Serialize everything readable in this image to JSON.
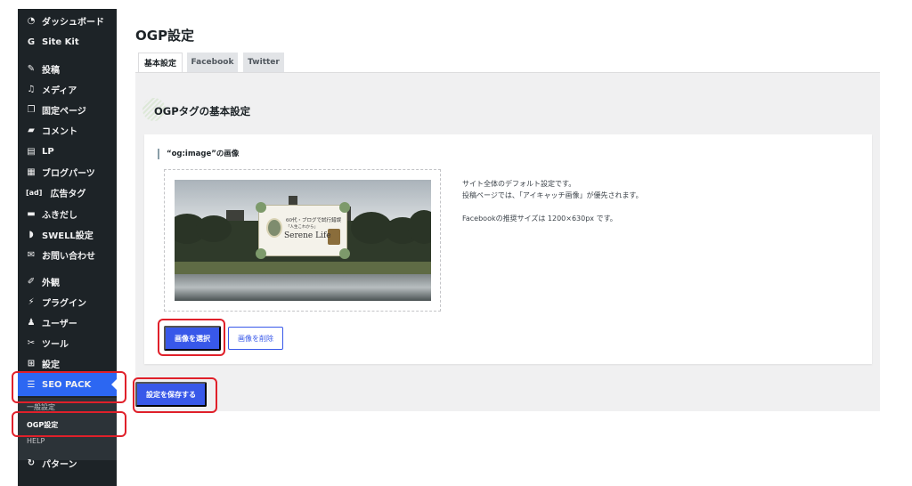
{
  "sidebar": {
    "items": [
      {
        "label": "ダッシュボード",
        "icon": "dashboard-icon"
      },
      {
        "label": "Site Kit",
        "icon": "google-g-icon"
      },
      {
        "label": "投稿",
        "icon": "pin-icon"
      },
      {
        "label": "メディア",
        "icon": "media-icon"
      },
      {
        "label": "固定ページ",
        "icon": "pages-icon"
      },
      {
        "label": "コメント",
        "icon": "comment-icon"
      },
      {
        "label": "LP",
        "icon": "document-icon"
      },
      {
        "label": "ブログパーツ",
        "icon": "layout-icon"
      },
      {
        "label": "広告タグ",
        "icon": "ad-icon",
        "icon_text": "[ad]"
      },
      {
        "label": "ふきだし",
        "icon": "speech-bubble-icon"
      },
      {
        "label": "SWELL設定",
        "icon": "swell-icon"
      },
      {
        "label": "お問い合わせ",
        "icon": "mail-icon"
      },
      {
        "label": "外観",
        "icon": "brush-icon"
      },
      {
        "label": "プラグイン",
        "icon": "plugin-icon"
      },
      {
        "label": "ユーザー",
        "icon": "user-icon"
      },
      {
        "label": "ツール",
        "icon": "wrench-icon"
      },
      {
        "label": "設定",
        "icon": "settings-icon"
      },
      {
        "label": "SEO PACK",
        "icon": "list-icon"
      }
    ],
    "submenu": [
      {
        "label": "一般設定"
      },
      {
        "label": "OGP設定"
      }
    ],
    "help_label": "HELP",
    "pattern_label": "パターン"
  },
  "page": {
    "title": "OGP設定",
    "tabs": [
      {
        "label": "基本設定"
      },
      {
        "label": "Facebook"
      },
      {
        "label": "Twitter"
      }
    ],
    "section_title": "OGPタグの基本設定",
    "field_label": "“og:image”の画像",
    "description": [
      "サイト全体のデフォルト設定です。",
      "投稿ページでは、「アイキャッチ画像」が優先されます。",
      "Facebookの推奨サイズは 1200×630px です。"
    ],
    "select_image_label": "画像を選択",
    "remove_image_label": "画像を削除",
    "save_label": "設定を保存する"
  },
  "preview_banner": {
    "line1": "60代・ブログで試行錯誤",
    "line2": "「人生これから」",
    "line3": "Serene Life"
  },
  "colors": {
    "sidebar_bg": "#1d2327",
    "accent": "#2c67f2",
    "button": "#3858e9",
    "highlight": "#e0202a"
  }
}
